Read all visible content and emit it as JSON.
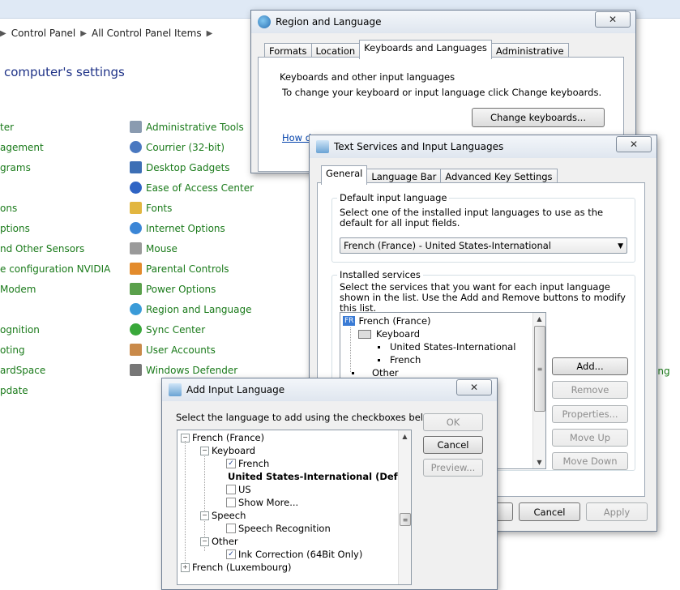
{
  "control_panel": {
    "breadcrumb": [
      "Control Panel",
      "All Control Panel Items"
    ],
    "heading": "computer's settings",
    "left_items": [
      "ter",
      "agement",
      "grams",
      "ons",
      "ptions",
      "nd Other Sensors",
      "e configuration NVIDIA",
      "Modem",
      "ognition",
      "oting",
      "ardSpace",
      "pdate"
    ],
    "right_items": [
      "Administrative Tools",
      "Courrier (32-bit)",
      "Desktop Gadgets",
      "Ease of Access Center",
      "Fonts",
      "Internet Options",
      "Mouse",
      "Parental Controls",
      "Power Options",
      "Region and Language",
      "Sync Center",
      "User Accounts",
      "Windows Defender"
    ],
    "far_right_item": "ing"
  },
  "region_dialog": {
    "title": "Region and Language",
    "close": "✕",
    "tabs": [
      "Formats",
      "Location",
      "Keyboards and Languages",
      "Administrative"
    ],
    "group_title": "Keyboards and other input languages",
    "instruction": "To change your keyboard or input language click Change keyboards.",
    "change_button": "Change keyboards...",
    "link_text": "How d"
  },
  "text_services_dialog": {
    "title": "Text Services and Input Languages",
    "close": "✕",
    "tabs": [
      "General",
      "Language Bar",
      "Advanced Key Settings"
    ],
    "default_group_title": "Default input language",
    "default_desc": "Select one of the installed input languages to use as the default for all input fields.",
    "default_value": "French (France) - United States-International",
    "installed_group_title": "Installed services",
    "installed_desc": "Select the services that you want for each input language shown in the list. Use the Add and Remove buttons to modify this list.",
    "tree": {
      "lang_badge": "FR",
      "language": "French (France)",
      "keyboard": "Keyboard",
      "layouts": [
        "United States-International",
        "French"
      ],
      "other": "Other"
    },
    "buttons": {
      "add": "Add...",
      "remove": "Remove",
      "properties": "Properties...",
      "move_up": "Move Up",
      "move_down": "Move Down",
      "cancel": "Cancel",
      "apply": "Apply"
    }
  },
  "add_language_dialog": {
    "title": "Add Input Language",
    "close": "✕",
    "instruction": "Select the language to add using the checkboxes below.",
    "buttons": {
      "ok": "OK",
      "cancel": "Cancel",
      "preview": "Preview..."
    },
    "tree": {
      "language": "French (France)",
      "keyboard": "Keyboard",
      "kb_french": "French",
      "kb_usintl": "United States-International (Default)",
      "kb_us": "US",
      "kb_more": "Show More...",
      "speech": "Speech",
      "speech_recognition": "Speech Recognition",
      "other": "Other",
      "ink": "Ink Correction (64Bit Only)",
      "next_language": "French (Luxembourg)"
    }
  }
}
